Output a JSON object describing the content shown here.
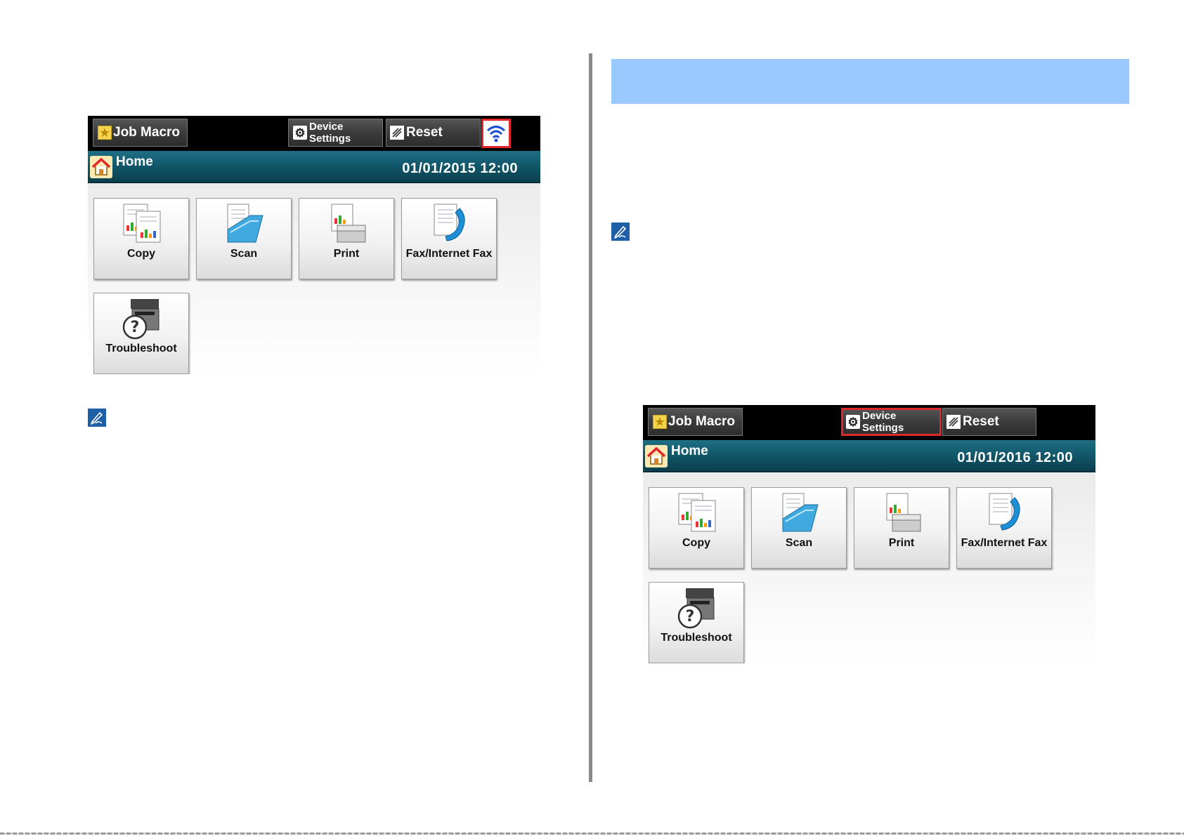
{
  "panels": [
    {
      "top_bar": {
        "job_macro_label": "Job Macro",
        "device_settings_label": "Device\nSettings",
        "reset_label": "Reset",
        "wireless_highlighted": true,
        "device_settings_highlighted": false
      },
      "home_bar": {
        "title": "Home",
        "datetime": "01/01/2015 12:00"
      },
      "tiles": [
        {
          "label": "Copy",
          "icon": "copy-icon"
        },
        {
          "label": "Scan",
          "icon": "scan-icon"
        },
        {
          "label": "Print",
          "icon": "print-icon"
        },
        {
          "label": "Fax/Internet Fax",
          "icon": "fax-icon"
        },
        {
          "label": "Troubleshoot",
          "icon": "troubleshoot-icon"
        }
      ]
    },
    {
      "top_bar": {
        "job_macro_label": "Job Macro",
        "device_settings_label": "Device\nSettings",
        "reset_label": "Reset",
        "wireless_highlighted": false,
        "device_settings_highlighted": true
      },
      "home_bar": {
        "title": "Home",
        "datetime": "01/01/2016 12:00"
      },
      "tiles": [
        {
          "label": "Copy",
          "icon": "copy-icon"
        },
        {
          "label": "Scan",
          "icon": "scan-icon"
        },
        {
          "label": "Print",
          "icon": "print-icon"
        },
        {
          "label": "Fax/Internet Fax",
          "icon": "fax-icon"
        },
        {
          "label": "Troubleshoot",
          "icon": "troubleshoot-icon"
        }
      ]
    }
  ],
  "colors": {
    "highlight": "#e0262a",
    "home_bar": "#0f5163",
    "banner": "#99c9ff",
    "note_icon": "#1f5fa8"
  }
}
